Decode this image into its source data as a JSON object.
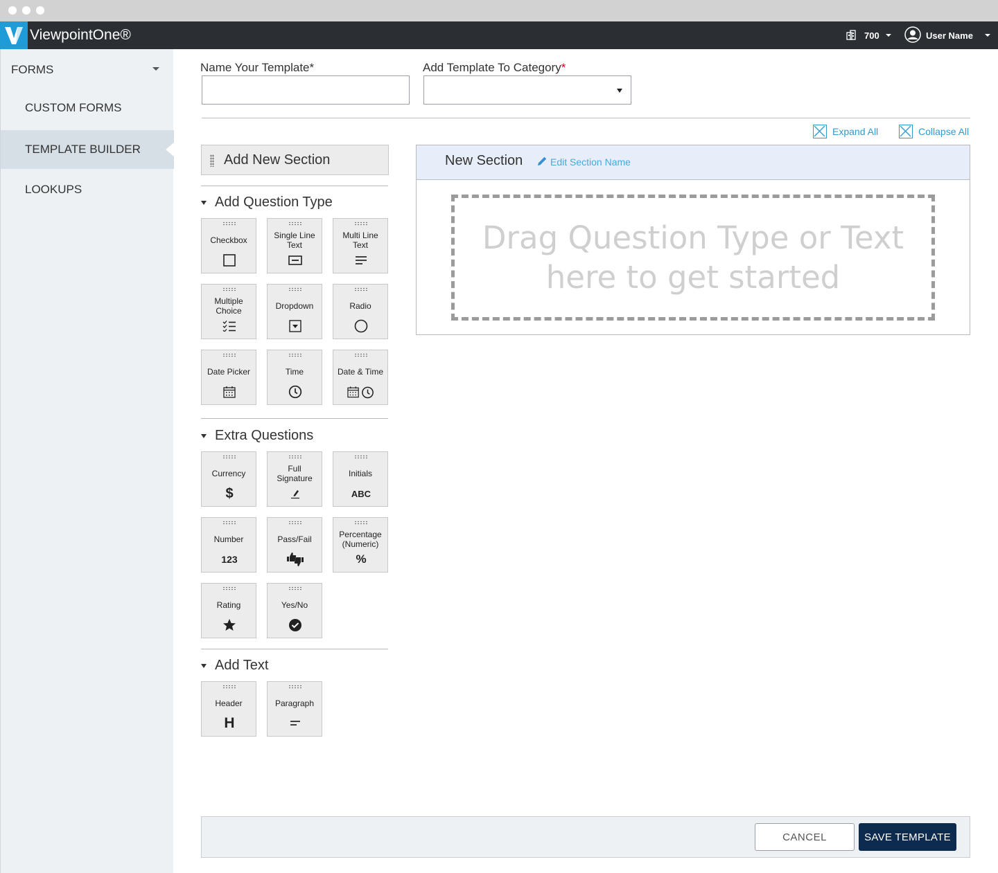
{
  "app": {
    "title": "ViewpointOne®",
    "company_number": "700",
    "user_name": "User Name",
    "brand_color": "#1f9bd7",
    "topbar_color": "#2b2f33"
  },
  "sidebar": {
    "heading": "FORMS",
    "items": [
      {
        "label": "CUSTOM FORMS",
        "active": false
      },
      {
        "label": "TEMPLATE BUILDER",
        "active": true
      },
      {
        "label": "LOOKUPS",
        "active": false
      }
    ]
  },
  "form": {
    "name_label": "Name Your Template",
    "name_required": "*",
    "name_value": "",
    "category_label": "Add Template To Category",
    "category_required": "*",
    "category_value": ""
  },
  "actions": {
    "expand_all": "Expand All",
    "collapse_all": "Collapse All"
  },
  "palette": {
    "add_section": "Add New Section",
    "question_group": "Add Question Type",
    "question_tiles": [
      {
        "label": "Checkbox",
        "icon": "checkbox-icon"
      },
      {
        "label": "Single Line Text",
        "icon": "single-line-text-icon"
      },
      {
        "label": "Multi Line Text",
        "icon": "multi-line-text-icon"
      },
      {
        "label": "Multiple Choice",
        "icon": "checklist-icon"
      },
      {
        "label": "Dropdown",
        "icon": "dropdown-icon"
      },
      {
        "label": "Radio",
        "icon": "radio-icon"
      },
      {
        "label": "Date Picker",
        "icon": "calendar-icon"
      },
      {
        "label": "Time",
        "icon": "clock-icon"
      },
      {
        "label": "Date & Time",
        "icon": "calendar-clock-icon"
      }
    ],
    "extra_group": "Extra Questions",
    "extra_tiles": [
      {
        "label": "Currency",
        "icon": "dollar-icon",
        "glyph": "$"
      },
      {
        "label": "Full Signature",
        "icon": "signature-icon"
      },
      {
        "label": "Initials",
        "icon": "initials-icon",
        "glyph": "ABC"
      },
      {
        "label": "Number",
        "icon": "number-icon",
        "glyph": "123"
      },
      {
        "label": "Pass/Fail",
        "icon": "thumbs-icon"
      },
      {
        "label": "Percentage (Numeric)",
        "icon": "percent-icon",
        "glyph": "%"
      },
      {
        "label": "Rating",
        "icon": "star-icon"
      },
      {
        "label": "Yes/No",
        "icon": "check-circle-icon"
      }
    ],
    "text_group": "Add Text",
    "text_tiles": [
      {
        "label": "Header",
        "icon": "header-icon",
        "glyph": "H"
      },
      {
        "label": "Paragraph",
        "icon": "paragraph-icon"
      }
    ]
  },
  "section": {
    "title": "New Section",
    "edit_label": "Edit Section Name",
    "drop_line1": "Drag Question Type or Text",
    "drop_line2": "here to get started"
  },
  "footer": {
    "cancel": "CANCEL",
    "save": "SAVE TEMPLATE"
  }
}
